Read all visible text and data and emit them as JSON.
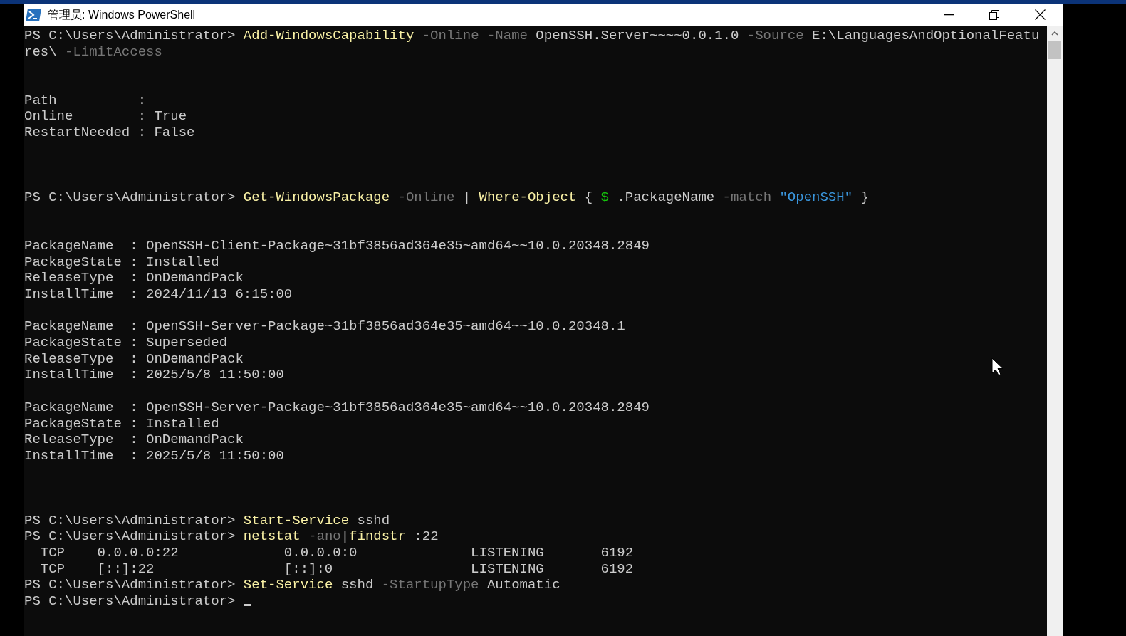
{
  "window": {
    "title": "管理员: Windows PowerShell"
  },
  "console": {
    "lines": [
      {
        "kind": "text",
        "segments": [
          {
            "kind": "plain",
            "text": "PS C:\\Users\\Administrator> "
          },
          {
            "kind": "command",
            "text": "Add-WindowsCapability"
          },
          {
            "kind": "param",
            "text": " -Online -Name"
          },
          {
            "kind": "plain",
            "text": " OpenSSH.Server~~~~0.0.1.0"
          },
          {
            "kind": "param",
            "text": " -Source"
          },
          {
            "kind": "plain",
            "text": " E:\\LanguagesAndOptionalFeatu"
          }
        ]
      },
      {
        "kind": "text",
        "segments": [
          {
            "kind": "plain",
            "text": "res\\"
          },
          {
            "kind": "param",
            "text": " -LimitAccess"
          }
        ]
      },
      {
        "kind": "blank"
      },
      {
        "kind": "blank"
      },
      {
        "kind": "text",
        "segments": [
          {
            "kind": "plain",
            "text": "Path          :"
          }
        ]
      },
      {
        "kind": "text",
        "segments": [
          {
            "kind": "plain",
            "text": "Online        : True"
          }
        ]
      },
      {
        "kind": "text",
        "segments": [
          {
            "kind": "plain",
            "text": "RestartNeeded : False"
          }
        ]
      },
      {
        "kind": "blank"
      },
      {
        "kind": "blank"
      },
      {
        "kind": "blank"
      },
      {
        "kind": "text",
        "segments": [
          {
            "kind": "plain",
            "text": "PS C:\\Users\\Administrator> "
          },
          {
            "kind": "command",
            "text": "Get-WindowsPackage"
          },
          {
            "kind": "param",
            "text": " -Online"
          },
          {
            "kind": "plain",
            "text": " | "
          },
          {
            "kind": "command",
            "text": "Where-Object"
          },
          {
            "kind": "plain",
            "text": " { "
          },
          {
            "kind": "variable",
            "text": "$_"
          },
          {
            "kind": "plain",
            "text": ".PackageName"
          },
          {
            "kind": "param",
            "text": " -match"
          },
          {
            "kind": "string",
            "text": " \"OpenSSH\""
          },
          {
            "kind": "plain",
            "text": " }"
          }
        ]
      },
      {
        "kind": "blank"
      },
      {
        "kind": "blank"
      },
      {
        "kind": "text",
        "segments": [
          {
            "kind": "plain",
            "text": "PackageName  : OpenSSH-Client-Package~31bf3856ad364e35~amd64~~10.0.20348.2849"
          }
        ]
      },
      {
        "kind": "text",
        "segments": [
          {
            "kind": "plain",
            "text": "PackageState : Installed"
          }
        ]
      },
      {
        "kind": "text",
        "segments": [
          {
            "kind": "plain",
            "text": "ReleaseType  : OnDemandPack"
          }
        ]
      },
      {
        "kind": "text",
        "segments": [
          {
            "kind": "plain",
            "text": "InstallTime  : 2024/11/13 6:15:00"
          }
        ]
      },
      {
        "kind": "blank"
      },
      {
        "kind": "text",
        "segments": [
          {
            "kind": "plain",
            "text": "PackageName  : OpenSSH-Server-Package~31bf3856ad364e35~amd64~~10.0.20348.1"
          }
        ]
      },
      {
        "kind": "text",
        "segments": [
          {
            "kind": "plain",
            "text": "PackageState : Superseded"
          }
        ]
      },
      {
        "kind": "text",
        "segments": [
          {
            "kind": "plain",
            "text": "ReleaseType  : OnDemandPack"
          }
        ]
      },
      {
        "kind": "text",
        "segments": [
          {
            "kind": "plain",
            "text": "InstallTime  : 2025/5/8 11:50:00"
          }
        ]
      },
      {
        "kind": "blank"
      },
      {
        "kind": "text",
        "segments": [
          {
            "kind": "plain",
            "text": "PackageName  : OpenSSH-Server-Package~31bf3856ad364e35~amd64~~10.0.20348.2849"
          }
        ]
      },
      {
        "kind": "text",
        "segments": [
          {
            "kind": "plain",
            "text": "PackageState : Installed"
          }
        ]
      },
      {
        "kind": "text",
        "segments": [
          {
            "kind": "plain",
            "text": "ReleaseType  : OnDemandPack"
          }
        ]
      },
      {
        "kind": "text",
        "segments": [
          {
            "kind": "plain",
            "text": "InstallTime  : 2025/5/8 11:50:00"
          }
        ]
      },
      {
        "kind": "blank"
      },
      {
        "kind": "blank"
      },
      {
        "kind": "blank"
      },
      {
        "kind": "text",
        "segments": [
          {
            "kind": "plain",
            "text": "PS C:\\Users\\Administrator> "
          },
          {
            "kind": "command",
            "text": "Start-Service"
          },
          {
            "kind": "plain",
            "text": " sshd"
          }
        ]
      },
      {
        "kind": "text",
        "segments": [
          {
            "kind": "plain",
            "text": "PS C:\\Users\\Administrator> "
          },
          {
            "kind": "command",
            "text": "netstat"
          },
          {
            "kind": "param",
            "text": " -ano"
          },
          {
            "kind": "plain",
            "text": "|"
          },
          {
            "kind": "command",
            "text": "findstr"
          },
          {
            "kind": "plain",
            "text": " :22"
          }
        ]
      },
      {
        "kind": "text",
        "segments": [
          {
            "kind": "plain",
            "text": "  TCP    0.0.0.0:22             0.0.0.0:0              LISTENING       6192"
          }
        ]
      },
      {
        "kind": "text",
        "segments": [
          {
            "kind": "plain",
            "text": "  TCP    [::]:22                [::]:0                 LISTENING       6192"
          }
        ]
      },
      {
        "kind": "text",
        "segments": [
          {
            "kind": "plain",
            "text": "PS C:\\Users\\Administrator> "
          },
          {
            "kind": "command",
            "text": "Set-Service"
          },
          {
            "kind": "plain",
            "text": " sshd"
          },
          {
            "kind": "param",
            "text": " -StartupType"
          },
          {
            "kind": "plain",
            "text": " Automatic"
          }
        ]
      },
      {
        "kind": "prompt",
        "segments": [
          {
            "kind": "plain",
            "text": "PS C:\\Users\\Administrator> "
          }
        ]
      }
    ]
  }
}
